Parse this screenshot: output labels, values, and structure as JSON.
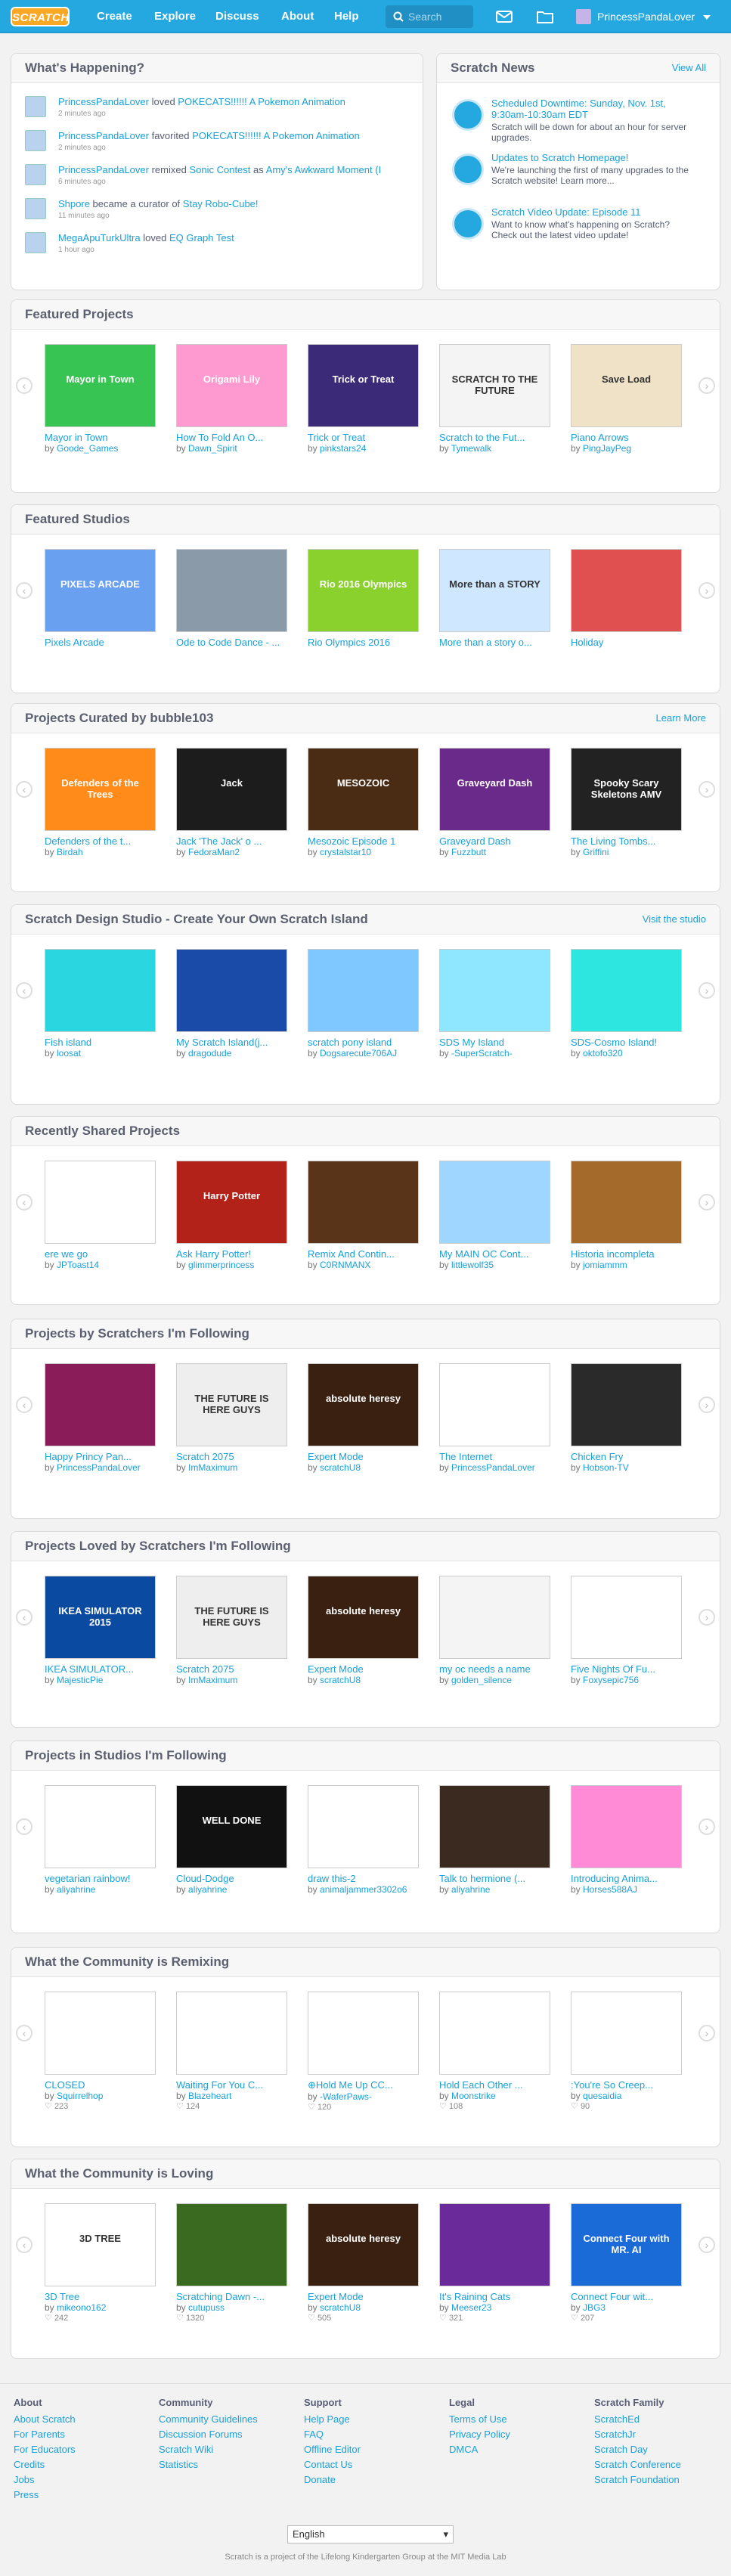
{
  "nav": {
    "logo": "SCRATCH",
    "create": "Create",
    "explore": "Explore",
    "discuss": "Discuss",
    "about": "About",
    "help": "Help",
    "search_placeholder": "Search",
    "username": "PrincessPandaLover"
  },
  "happening": {
    "title": "What's Happening?",
    "items": [
      {
        "user": "PrincessPandaLover",
        "verb": "loved",
        "target": "POKECATS!!!!!! A Pokemon Animation",
        "time": "2 minutes ago"
      },
      {
        "user": "PrincessPandaLover",
        "verb": "favorited",
        "target": "POKECATS!!!!!! A Pokemon Animation",
        "time": "2 minutes ago"
      },
      {
        "user": "PrincessPandaLover",
        "verb": "remixed",
        "target": "Sonic Contest",
        "verb2": "as",
        "target2": "Amy's Awkward Moment (I",
        "time": "6 minutes ago"
      },
      {
        "user": "Shpore",
        "verb": "became a curator of",
        "target": "Stay Robo-Cube!",
        "time": "11 minutes ago"
      },
      {
        "user": "MegaApuTurkUltra",
        "verb": "loved",
        "target": "EQ Graph Test",
        "time": "1 hour ago"
      }
    ]
  },
  "news": {
    "title": "Scratch News",
    "view_all": "View All",
    "items": [
      {
        "title": "Scheduled Downtime: Sunday, Nov. 1st, 9:30am-10:30am EDT",
        "desc": "Scratch will be down for about an hour for server upgrades."
      },
      {
        "title": "Updates to Scratch Homepage!",
        "desc": "We're launching the first of many upgrades to the Scratch website! Learn more..."
      },
      {
        "title": "Scratch Video Update: Episode 11",
        "desc": "Want to know what's happening on Scratch? Check out the latest video update!"
      }
    ]
  },
  "rows": [
    {
      "title": "Featured Projects",
      "link": "",
      "items": [
        {
          "title": "Mayor in Town",
          "author": "Goode_Games",
          "art": "Mayor in Town",
          "color": "#37c452"
        },
        {
          "title": "How To Fold An O...",
          "author": "Dawn_Spirit",
          "art": "Origami Lily",
          "color": "#ff9ad1"
        },
        {
          "title": "Trick or Treat",
          "author": "pinkstars24",
          "art": "Trick or Treat",
          "color": "#3a2a78"
        },
        {
          "title": "Scratch to the Fut...",
          "author": "Tymewalk",
          "art": "SCRATCH TO THE FUTURE",
          "color": "#f4f4f4"
        },
        {
          "title": "Piano Arrows",
          "author": "PingJayPeg",
          "art": "Save Load",
          "color": "#f0e2c6"
        }
      ]
    },
    {
      "title": "Featured Studios",
      "link": "",
      "items": [
        {
          "title": "Pixels Arcade",
          "author": "",
          "art": "PIXELS ARCADE",
          "color": "#6aa0f0"
        },
        {
          "title": "Ode to Code Dance - ...",
          "author": "",
          "art": "",
          "color": "#8a9aa8"
        },
        {
          "title": "Rio Olympics 2016",
          "author": "",
          "art": "Rio 2016 Olympics",
          "color": "#8bd12e"
        },
        {
          "title": "More than a story o...",
          "author": "",
          "art": "More than a STORY",
          "color": "#cfe8ff"
        },
        {
          "title": "Holiday",
          "author": "",
          "art": "",
          "color": "#e05050"
        }
      ]
    },
    {
      "title": "Projects Curated by bubble103",
      "link": "Learn More",
      "items": [
        {
          "title": "Defenders of the t...",
          "author": "Birdah",
          "art": "Defenders of the Trees",
          "color": "#ff8c1a"
        },
        {
          "title": "Jack 'The Jack' o ...",
          "author": "FedoraMan2",
          "art": "Jack",
          "color": "#1c1c1c"
        },
        {
          "title": "Mesozoic Episode 1",
          "author": "crystalstar10",
          "art": "MESOZOIC",
          "color": "#4a2b14"
        },
        {
          "title": "Graveyard Dash",
          "author": "Fuzzbutt",
          "art": "Graveyard Dash",
          "color": "#6a2a8a"
        },
        {
          "title": "The Living Tombs...",
          "author": "Griffini",
          "art": "Spooky Scary Skeletons AMV",
          "color": "#222"
        }
      ]
    },
    {
      "title": "Scratch Design Studio - Create Your Own Scratch Island",
      "link": "Visit the studio",
      "items": [
        {
          "title": "Fish island",
          "author": "loosat",
          "art": "",
          "color": "#2ad6e0"
        },
        {
          "title": "My Scratch Island(j...",
          "author": "dragodude",
          "art": "",
          "color": "#1a4ba8"
        },
        {
          "title": "scratch pony island",
          "author": "Dogsarecute706AJ",
          "art": "",
          "color": "#7ec8ff"
        },
        {
          "title": "SDS My Island",
          "author": "-SuperScratch-",
          "art": "",
          "color": "#8ee6ff"
        },
        {
          "title": "SDS-Cosmo Island!",
          "author": "oktofo320",
          "art": "",
          "color": "#2ee6e0"
        }
      ]
    },
    {
      "title": "Recently Shared Projects",
      "link": "",
      "items": [
        {
          "title": "ere we go",
          "author": "JPToast14",
          "art": "",
          "color": "#fff"
        },
        {
          "title": "Ask Harry Potter!",
          "author": "glimmerprincess",
          "art": "Harry Potter",
          "color": "#b22218"
        },
        {
          "title": "Remix And Contin...",
          "author": "C0RNMANX",
          "art": "",
          "color": "#5a3418"
        },
        {
          "title": "My MAIN OC Cont...",
          "author": "littlewolf35",
          "art": "",
          "color": "#9fd6ff"
        },
        {
          "title": "Historia incompleta",
          "author": "jomiammm",
          "art": "",
          "color": "#a36a2c"
        }
      ]
    },
    {
      "title": "Projects by Scratchers I'm Following",
      "link": "",
      "items": [
        {
          "title": "Happy Princy Pan...",
          "author": "PrincessPandaLover",
          "art": "",
          "color": "#8a1c5a"
        },
        {
          "title": "Scratch 2075",
          "author": "ImMaximum",
          "art": "THE FUTURE IS HERE GUYS",
          "color": "#eee"
        },
        {
          "title": "Expert Mode",
          "author": "scratchU8",
          "art": "absolute heresy",
          "color": "#3a2010"
        },
        {
          "title": "The Internet",
          "author": "PrincessPandaLover",
          "art": "",
          "color": "#fff"
        },
        {
          "title": "Chicken Fry",
          "author": "Hobson-TV",
          "art": "",
          "color": "#2a2a2a"
        }
      ]
    },
    {
      "title": "Projects Loved by Scratchers I'm Following",
      "link": "",
      "items": [
        {
          "title": "IKEA SIMULATOR...",
          "author": "MajesticPie",
          "art": "IKEA SIMULATOR 2015",
          "color": "#0a4aa0"
        },
        {
          "title": "Scratch 2075",
          "author": "ImMaximum",
          "art": "THE FUTURE IS HERE GUYS",
          "color": "#eee"
        },
        {
          "title": "Expert Mode",
          "author": "scratchU8",
          "art": "absolute heresy",
          "color": "#3a2010"
        },
        {
          "title": "my oc needs a name",
          "author": "golden_silence",
          "art": "",
          "color": "#f4f4f4"
        },
        {
          "title": "Five Nights Of Fu...",
          "author": "Foxysepic756",
          "art": "",
          "color": "#fff"
        }
      ]
    },
    {
      "title": "Projects in Studios I'm Following",
      "link": "",
      "items": [
        {
          "title": "vegetarian rainbow!",
          "author": "aliyahrine",
          "art": "",
          "color": "#fff"
        },
        {
          "title": "Cloud-Dodge",
          "author": "aliyahrine",
          "art": "WELL DONE",
          "color": "#111"
        },
        {
          "title": "draw this-2",
          "author": "animaljammer3302o6",
          "art": "",
          "color": "#fff"
        },
        {
          "title": "Talk to hermione (...",
          "author": "aliyahrine",
          "art": "",
          "color": "#3a2a20"
        },
        {
          "title": "Introducing Anima...",
          "author": "Horses588AJ",
          "art": "",
          "color": "#ff8ad6"
        }
      ]
    },
    {
      "title": "What the Community is Remixing",
      "link": "",
      "items": [
        {
          "title": "CLOSED",
          "author": "Squirrelhop",
          "count": "223",
          "art": "",
          "color": "#fff"
        },
        {
          "title": "Waiting For You C...",
          "author": "Blazeheart",
          "count": "124",
          "art": "",
          "color": "#fff"
        },
        {
          "title": "⊕Hold Me Up CC...",
          "author": "-WaferPaws-",
          "count": "120",
          "art": "",
          "color": "#fff"
        },
        {
          "title": "Hold Each Other ...",
          "author": "Moonstrike",
          "count": "108",
          "art": "",
          "color": "#fff"
        },
        {
          "title": ":You're So Creep...",
          "author": "quesaidia",
          "count": "90",
          "art": "",
          "color": "#fff"
        }
      ]
    },
    {
      "title": "What the Community is Loving",
      "link": "",
      "items": [
        {
          "title": "3D Tree",
          "author": "mikeono162",
          "count": "242",
          "art": "3D TREE",
          "color": "#fff"
        },
        {
          "title": "Scratching Dawn -...",
          "author": "cutupuss",
          "count": "1320",
          "art": "",
          "color": "#3a6a20"
        },
        {
          "title": "Expert Mode",
          "author": "scratchU8",
          "count": "505",
          "art": "absolute heresy",
          "color": "#3a2010"
        },
        {
          "title": "It's Raining Cats",
          "author": "Meeser23",
          "count": "321",
          "art": "",
          "color": "#6a2a9a"
        },
        {
          "title": "Connect Four wit...",
          "author": "JBG3",
          "count": "207",
          "art": "Connect Four with MR. AI",
          "color": "#1a6ad8"
        }
      ]
    }
  ],
  "footer": {
    "cols": [
      {
        "title": "About",
        "links": [
          "About Scratch",
          "For Parents",
          "For Educators",
          "Credits",
          "Jobs",
          "Press"
        ]
      },
      {
        "title": "Community",
        "links": [
          "Community Guidelines",
          "Discussion Forums",
          "Scratch Wiki",
          "Statistics"
        ]
      },
      {
        "title": "Support",
        "links": [
          "Help Page",
          "FAQ",
          "Offline Editor",
          "Contact Us",
          "Donate"
        ]
      },
      {
        "title": "Legal",
        "links": [
          "Terms of Use",
          "Privacy Policy",
          "DMCA"
        ]
      },
      {
        "title": "Scratch Family",
        "links": [
          "ScratchEd",
          "ScratchJr",
          "Scratch Day",
          "Scratch Conference",
          "Scratch Foundation"
        ]
      }
    ],
    "language": "English",
    "tagline": "Scratch is a project of the Lifelong Kindergarten Group at the MIT Media Lab"
  }
}
